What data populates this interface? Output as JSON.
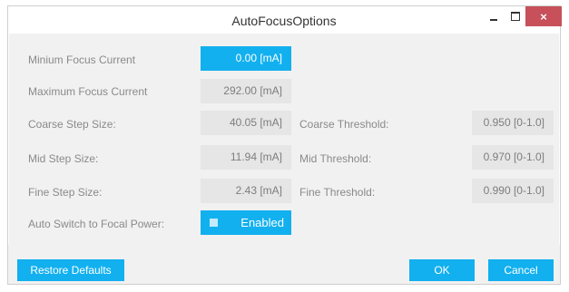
{
  "window": {
    "title": "AutoFocusOptions",
    "close_glyph": "×"
  },
  "fields": {
    "min_focus_current": {
      "label": "Minium Focus Current",
      "value": "0.00 [mA]"
    },
    "max_focus_current": {
      "label": "Maximum Focus Current",
      "value": "292.00 [mA]"
    },
    "coarse_step": {
      "label": "Coarse Step Size:",
      "value": "40.05 [mA]"
    },
    "mid_step": {
      "label": "Mid Step Size:",
      "value": "11.94 [mA]"
    },
    "fine_step": {
      "label": "Fine Step Size:",
      "value": "2.43 [mA]"
    },
    "coarse_threshold": {
      "label": "Coarse Threshold:",
      "value": "0.950 [0-1.0]"
    },
    "mid_threshold": {
      "label": "Mid Threshold:",
      "value": "0.970 [0-1.0]"
    },
    "fine_threshold": {
      "label": "Fine Threshold:",
      "value": "0.990 [0-1.0]"
    },
    "auto_switch": {
      "label": "Auto Switch to Focal Power:",
      "value": "Enabled"
    }
  },
  "buttons": {
    "restore_defaults": "Restore Defaults",
    "ok": "OK",
    "cancel": "Cancel"
  },
  "colors": {
    "accent": "#12b0ef",
    "close": "#c7505a",
    "field_bg": "#e6e6e6",
    "panel_bg": "#f1f1f1"
  }
}
